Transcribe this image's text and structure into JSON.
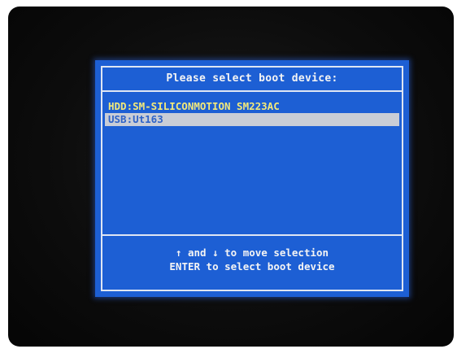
{
  "dialog": {
    "title": "Please select boot device:"
  },
  "devices": [
    {
      "label": "HDD:SM-SILICONMOTION SM223AC"
    },
    {
      "label": "USB:Ut163"
    }
  ],
  "help": {
    "line1": "↑ and ↓ to move selection",
    "line2": "ENTER to select boot device"
  },
  "colors": {
    "panel_bg": "#1d5fd4",
    "item_text": "#f3e97a",
    "selected_bg": "#c9cdd6",
    "selected_text": "#2f63c8",
    "border": "#dfe6f3"
  }
}
